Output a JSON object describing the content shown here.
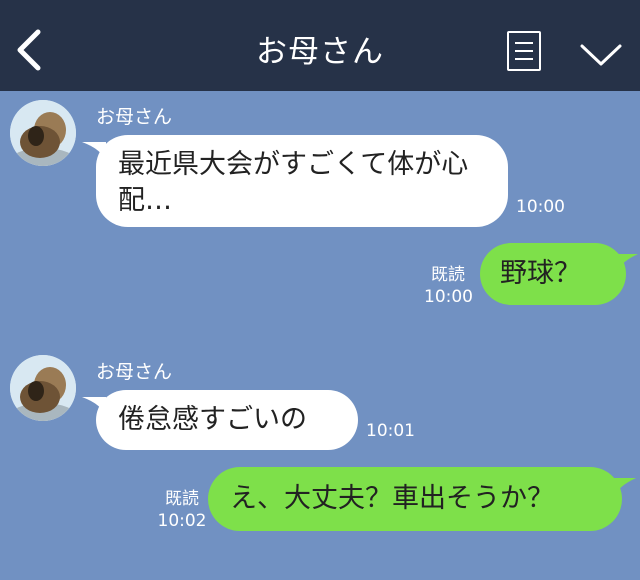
{
  "header": {
    "title": "お母さん",
    "back_icon": "chevron-left-icon",
    "menu_icon": "menu-list-icon",
    "collapse_icon": "chevron-down-icon"
  },
  "messages": [
    {
      "sender": "お母さん",
      "text": "最近県大会がすごくて体が心配…",
      "time": "10:00"
    },
    {
      "text": "野球？",
      "read": "既読",
      "time": "10:00"
    },
    {
      "sender": "お母さん",
      "text": "倦怠感すごいの",
      "time": "10:01"
    },
    {
      "text": "え、大丈夫？車出そうか？",
      "read": "既読",
      "time": "10:02"
    }
  ],
  "colors": {
    "background": "#7191c2",
    "header": "#263248",
    "incoming": "#ffffff",
    "outgoing": "#7ee04a"
  }
}
